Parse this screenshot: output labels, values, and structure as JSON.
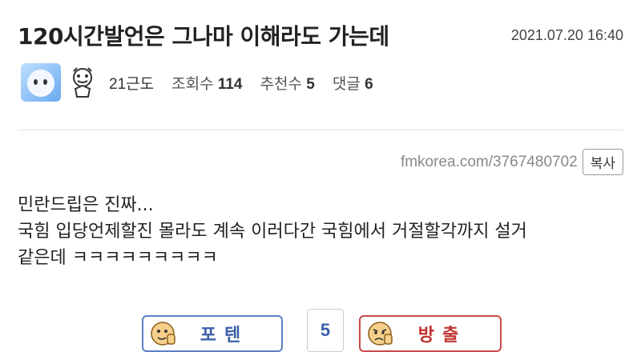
{
  "post": {
    "title": "120시간발언은 그나마 이해라도 가는데",
    "date": "2021.07.20 16:40",
    "author": "21근도",
    "views_label": "조회수",
    "views": "114",
    "recommend_label": "추천수",
    "recommend": "5",
    "comments_label": "댓글",
    "comments": "6",
    "url": "fmkorea.com/3767480702",
    "copy_label": "복사",
    "body_lines": [
      "민란드립은 진짜...",
      "국힘 입당언제할진 몰라도 계속 이러다간 국힘에서 거절할각까지 설거",
      "같은데 ㅋㅋㅋㅋㅋㅋㅋㅋㅋ"
    ]
  },
  "vote": {
    "up_label": "포텐",
    "count": "5",
    "down_label": "방출"
  },
  "colors": {
    "up_accent": "#3b5ea8",
    "down_accent": "#c0312f"
  },
  "icons": {
    "avatar": "profile-avatar",
    "level": "level-icon",
    "up": "thumbs-up-face-icon",
    "down": "thumbs-down-face-icon"
  }
}
